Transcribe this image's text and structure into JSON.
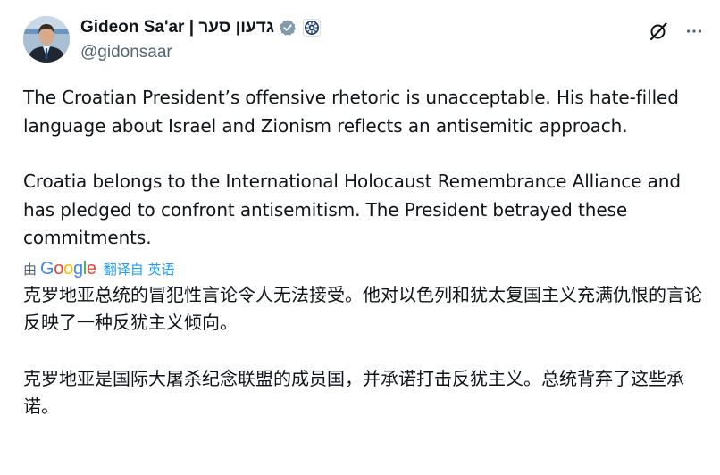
{
  "author": {
    "display_name": "Gideon Sa'ar | גדעון סער",
    "handle": "@gidonsaar",
    "verified_badge_icon": "verified-badge-icon",
    "affiliate_badge_icon": "government-emblem-icon"
  },
  "actions": {
    "grok_icon": "grok-icon",
    "more_icon": "more-icon"
  },
  "tweet": {
    "paragraph_1": "The Croatian President’s offensive rhetoric is unacceptable. His hate-filled language about Israel and Zionism reflects an antisemitic approach.",
    "paragraph_2": "Croatia belongs to the International Holocaust Remembrance Alliance and has pledged to confront antisemitism. The President betrayed these commitments."
  },
  "translation": {
    "by_label": "由",
    "provider": "Google",
    "translated_from": "翻译自 英语",
    "paragraph_1": "克罗地亚总统的冒犯性言论令人无法接受。他对以色列和犹太复国主义充满仇恨的言论反映了一种反犹主义倾向。",
    "paragraph_2": "克罗地亚是国际大屠杀纪念联盟的成员国，并承诺打击反犹主义。总统背弃了这些承诺。"
  },
  "colors": {
    "text": "#0f1419",
    "secondary": "#536471",
    "link": "#1d9bf0",
    "verified_gray": "#829aab"
  }
}
